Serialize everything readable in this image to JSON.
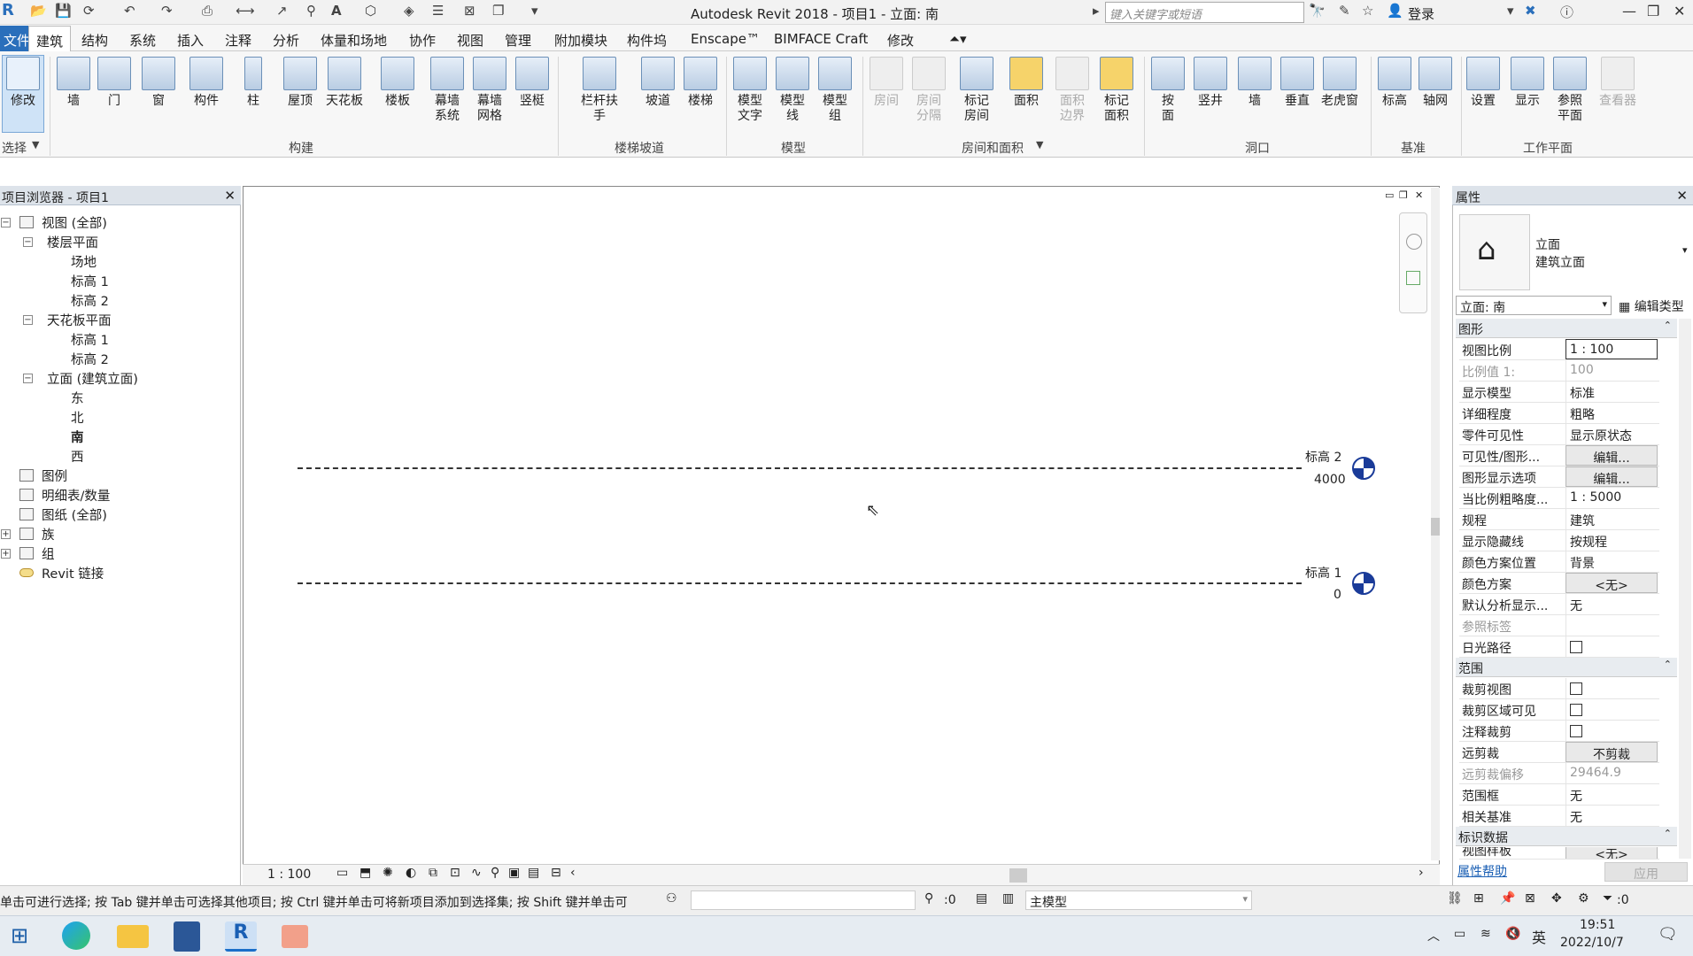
{
  "window": {
    "title": "Autodesk Revit 2018 -     项目1 - 立面: 南",
    "search_placeholder": "键入关键字或短语",
    "login": "登录"
  },
  "menu": {
    "file": "文件",
    "tabs": [
      "建筑",
      "结构",
      "系统",
      "插入",
      "注释",
      "分析",
      "体量和场地",
      "协作",
      "视图",
      "管理",
      "附加模块",
      "构件坞",
      "Enscape™",
      "BIMFACE Craft",
      "修改"
    ]
  },
  "ribbon": {
    "select_label": "选择",
    "buttons": {
      "modify": "修改",
      "wall": "墙",
      "door": "门",
      "window": "窗",
      "component": "构件",
      "column": "柱",
      "roof": "屋顶",
      "ceiling": "天花板",
      "floor": "楼板",
      "curtain_system_1": "幕墙",
      "curtain_system_2": "系统",
      "curtain_grid_1": "幕墙",
      "curtain_grid_2": "网格",
      "mullion": "竖梃",
      "railing": "栏杆扶手",
      "ramp": "坡道",
      "stair": "楼梯",
      "model_text_1": "模型",
      "model_text_2": "文字",
      "model_line_1": "模型",
      "model_line_2": "线",
      "model_group_1": "模型",
      "model_group_2": "组",
      "room": "房间",
      "room_sep_1": "房间",
      "room_sep_2": "分隔",
      "tag_room_1": "标记",
      "tag_room_2": "房间",
      "area": "面积",
      "area_boundary_1": "面积",
      "area_boundary_2": "边界",
      "tag_area_1": "标记",
      "tag_area_2": "面积",
      "by_face_1": "按",
      "by_face_2": "面",
      "shaft": "竖井",
      "wall_opening": "墙",
      "vertical": "垂直",
      "dormer": "老虎窗",
      "level": "标高",
      "grid": "轴网",
      "set": "设置",
      "show": "显示",
      "ref_plane_1": "参照",
      "ref_plane_2": "平面",
      "viewer": "查看器"
    },
    "groups": [
      "构建",
      "楼梯坡道",
      "模型",
      "房间和面积",
      "洞口",
      "基准",
      "工作平面"
    ]
  },
  "project_browser": {
    "title": "项目浏览器 - 项目1",
    "items": [
      {
        "label": "视图 (全部)"
      },
      {
        "label": "楼层平面"
      },
      {
        "label": "场地"
      },
      {
        "label": "标高 1"
      },
      {
        "label": "标高 2"
      },
      {
        "label": "天花板平面"
      },
      {
        "label": "标高 1"
      },
      {
        "label": "标高 2"
      },
      {
        "label": "立面 (建筑立面)"
      },
      {
        "label": "东"
      },
      {
        "label": "北"
      },
      {
        "label": "南"
      },
      {
        "label": "西"
      },
      {
        "label": "图例"
      },
      {
        "label": "明细表/数量"
      },
      {
        "label": "图纸 (全部)"
      },
      {
        "label": "族"
      },
      {
        "label": "组"
      },
      {
        "label": "Revit 链接"
      }
    ]
  },
  "canvas": {
    "levels": [
      {
        "name": "标高 2",
        "value": "4000"
      },
      {
        "name": "标高 1",
        "value": "0"
      }
    ],
    "scale": "1 : 100"
  },
  "properties": {
    "title": "属性",
    "type_name_1": "立面",
    "type_name_2": "建筑立面",
    "selector": "立面: 南",
    "edit_type": "编辑类型",
    "sections": {
      "graphics": "图形",
      "extents": "范围",
      "identity": "标识数据"
    },
    "rows": [
      {
        "label": "视图比例",
        "value": "1 : 100"
      },
      {
        "label": "比例值 1:",
        "value": "100"
      },
      {
        "label": "显示模型",
        "value": "标准"
      },
      {
        "label": "详细程度",
        "value": "粗略"
      },
      {
        "label": "零件可见性",
        "value": "显示原状态"
      },
      {
        "label": "可见性/图形...",
        "value": "编辑..."
      },
      {
        "label": "图形显示选项",
        "value": "编辑..."
      },
      {
        "label": "当比例粗略度...",
        "value": "1 : 5000"
      },
      {
        "label": "规程",
        "value": "建筑"
      },
      {
        "label": "显示隐藏线",
        "value": "按规程"
      },
      {
        "label": "颜色方案位置",
        "value": "背景"
      },
      {
        "label": "颜色方案",
        "value": "<无>"
      },
      {
        "label": "默认分析显示...",
        "value": "无"
      },
      {
        "label": "参照标签",
        "value": ""
      },
      {
        "label": "日光路径",
        "value": ""
      },
      {
        "label": "裁剪视图",
        "value": ""
      },
      {
        "label": "裁剪区域可见",
        "value": ""
      },
      {
        "label": "注释裁剪",
        "value": ""
      },
      {
        "label": "远剪裁",
        "value": "不剪裁"
      },
      {
        "label": "远剪裁偏移",
        "value": "29464.9"
      },
      {
        "label": "范围框",
        "value": "无"
      },
      {
        "label": "相关基准",
        "value": "无"
      },
      {
        "label": "视图样板",
        "value": "<无>"
      }
    ],
    "help": "属性帮助",
    "apply": "应用"
  },
  "status": {
    "hint": "单击可进行选择; 按 Tab 键并单击可选择其他项目; 按 Ctrl 键并单击可将新项目添加到选择集; 按 Shift 键并单击可",
    "counter": ":0",
    "model": "主模型",
    "filter": ":0"
  },
  "taskbar": {
    "ime": "英",
    "time": "19:51",
    "date": "2022/10/7"
  }
}
